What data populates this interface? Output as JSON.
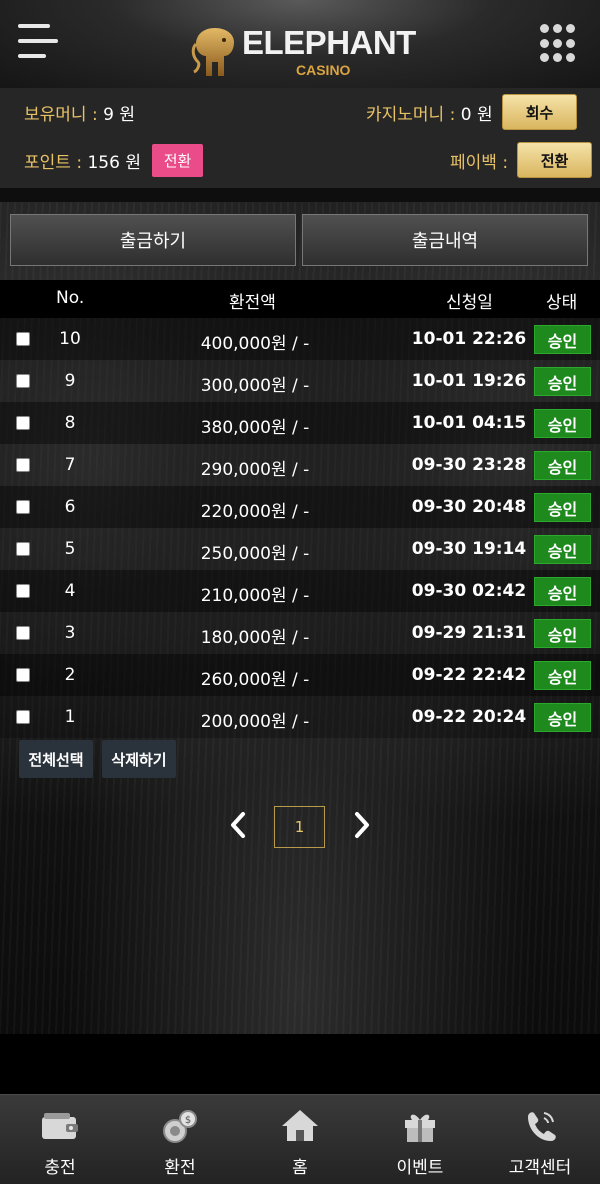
{
  "header": {
    "logo_title": "ELEPHANT",
    "logo_subtitle": "CASINO"
  },
  "balance": {
    "holding_label": "보유머니 : ",
    "holding_value": "9 원",
    "casino_label": "카지노머니 : ",
    "casino_value": "0 원",
    "retrieve_button": "회수",
    "point_label": "포인트 : ",
    "point_value": "156 원",
    "point_convert_button": "전환",
    "payback_label": "페이백 : ",
    "payback_convert_button": "전환"
  },
  "tabs": {
    "withdraw": "출금하기",
    "history": "출금내역"
  },
  "table": {
    "headers": {
      "no": "No.",
      "amount": "환전액",
      "date": "신청일",
      "status": "상태"
    },
    "rows": [
      {
        "no": "10",
        "amount": "400,000원 / -",
        "date": "10-01 22:26",
        "status": "승인"
      },
      {
        "no": "9",
        "amount": "300,000원 / -",
        "date": "10-01 19:26",
        "status": "승인"
      },
      {
        "no": "8",
        "amount": "380,000원 / -",
        "date": "10-01 04:15",
        "status": "승인"
      },
      {
        "no": "7",
        "amount": "290,000원 / -",
        "date": "09-30 23:28",
        "status": "승인"
      },
      {
        "no": "6",
        "amount": "220,000원 / -",
        "date": "09-30 20:48",
        "status": "승인"
      },
      {
        "no": "5",
        "amount": "250,000원 / -",
        "date": "09-30 19:14",
        "status": "승인"
      },
      {
        "no": "4",
        "amount": "210,000원 / -",
        "date": "09-30 02:42",
        "status": "승인"
      },
      {
        "no": "3",
        "amount": "180,000원 / -",
        "date": "09-29 21:31",
        "status": "승인"
      },
      {
        "no": "2",
        "amount": "260,000원 / -",
        "date": "09-22 22:42",
        "status": "승인"
      },
      {
        "no": "1",
        "amount": "200,000원 / -",
        "date": "09-22 20:24",
        "status": "승인"
      }
    ]
  },
  "actions": {
    "select_all": "전체선택",
    "delete": "삭제하기"
  },
  "pagination": {
    "current_page": "1"
  },
  "bottom_nav": {
    "items": [
      {
        "label": "충전",
        "icon": "wallet-icon"
      },
      {
        "label": "환전",
        "icon": "exchange-coins-icon"
      },
      {
        "label": "홈",
        "icon": "home-icon"
      },
      {
        "label": "이벤트",
        "icon": "gift-icon"
      },
      {
        "label": "고객센터",
        "icon": "phone-icon"
      }
    ]
  },
  "colors": {
    "gold_text": "#e8c266",
    "approved_badge": "#1e8a1e",
    "convert_pink": "#ea4c89",
    "gold_button": "#d9b55f"
  }
}
